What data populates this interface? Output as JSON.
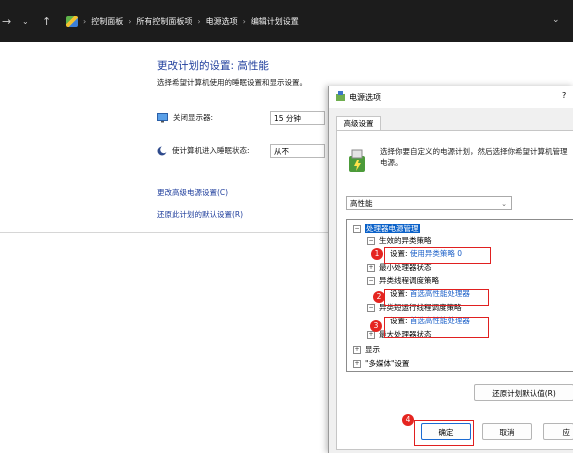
{
  "topbar": {
    "back_icon": "arrow-right-icon",
    "dropdown_icon": "chevron-down-icon",
    "up_icon": "arrow-up-icon",
    "breadcrumbs": [
      "控制面板",
      "所有控制面板项",
      "电源选项",
      "编辑计划设置"
    ]
  },
  "left": {
    "title": "更改计划的设置: 高性能",
    "subtitle": "选择希望计算机使用的睡眠设置和显示设置。",
    "display_label": "关闭显示器:",
    "display_value": "15 分钟",
    "sleep_label": "使计算机进入睡眠状态:",
    "sleep_value": "从不",
    "advanced_link": "更改高级电源设置(C)",
    "restore_link": "还原此计划的默认设置(R)"
  },
  "dialog": {
    "title": "电源选项",
    "help": "?",
    "tab": "高级设置",
    "intro": "选择你要自定义的电源计划，然后选择你希望计算机管理电源。",
    "plan": "高性能",
    "tree": {
      "n1": "处理器电源管理",
      "n2": "生效的异类策略",
      "n3_prefix": "设置:",
      "n3_value": "使用异类策略 0",
      "n4": "最小处理器状态",
      "n5": "异类线程调度策略",
      "n6_prefix": "设置:",
      "n6_value": "首选高性能处理器",
      "n7": "异类短运行线程调度策略",
      "n8_prefix": "设置:",
      "n8_value": "首选高性能处理器",
      "n9": "最大处理器状态",
      "n10": "显示",
      "n11": "\"多媒体\"设置"
    },
    "restore_button": "还原计划默认值(R)",
    "ok_button": "确定",
    "cancel_button": "取消",
    "apply_button": "应"
  },
  "badges": [
    "1",
    "2",
    "3",
    "4"
  ],
  "colors": {
    "accent": "#0a61c9",
    "link": "#1e3d9c",
    "annotation": "#e02020"
  }
}
